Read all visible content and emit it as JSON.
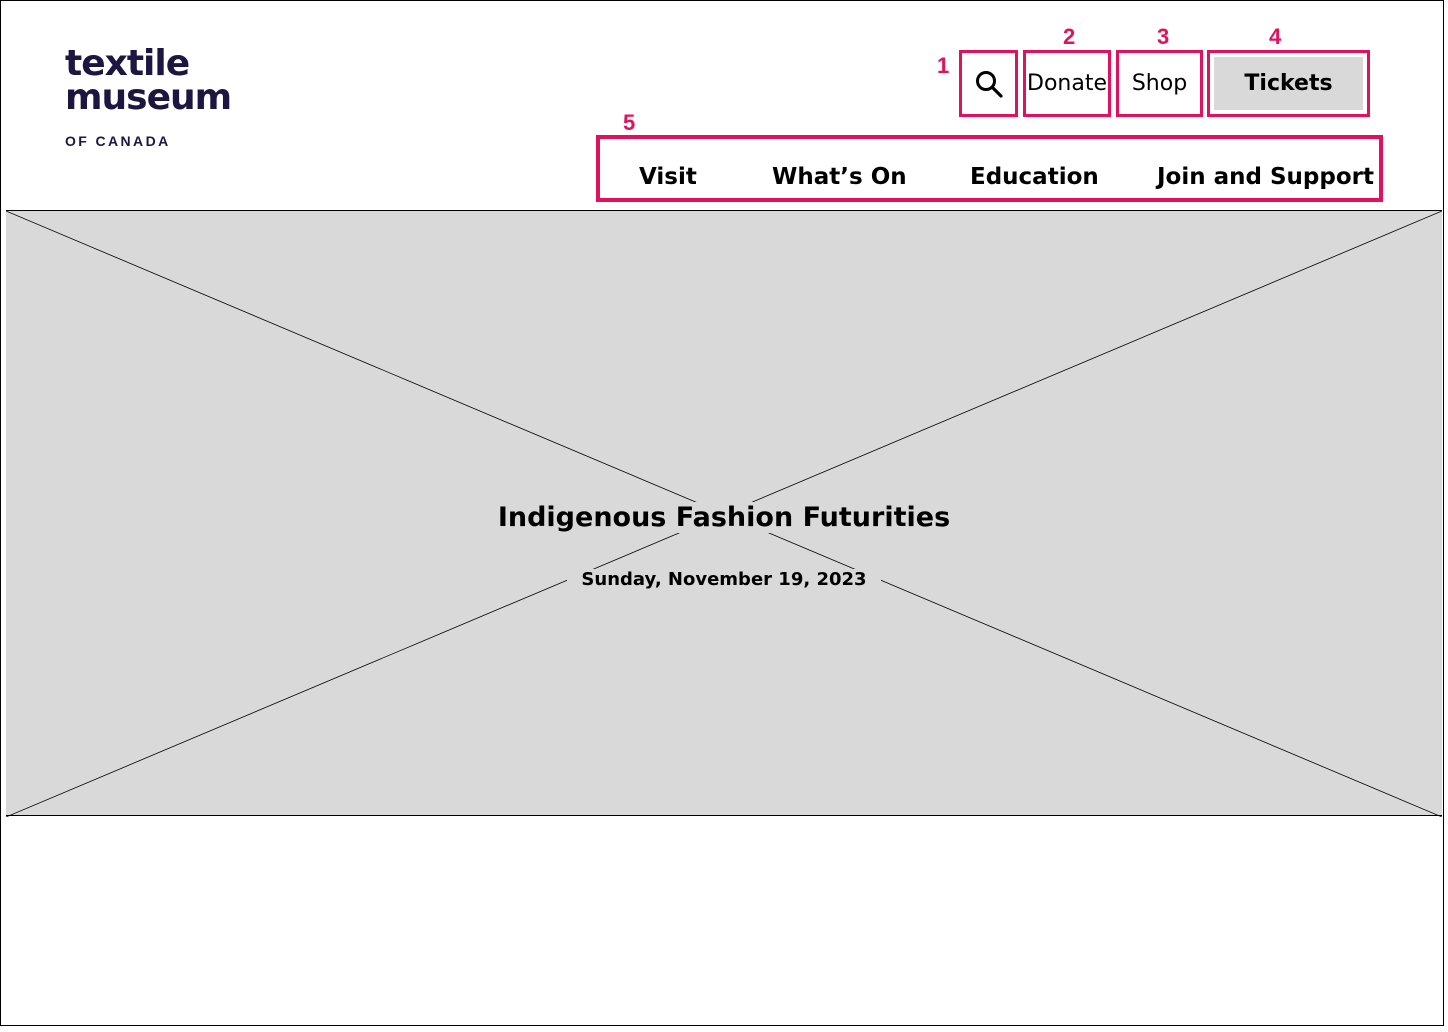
{
  "logo": {
    "line1": "textile",
    "line2": "museum",
    "line3": "OF CANADA"
  },
  "annotations": [
    "1",
    "2",
    "3",
    "4",
    "5"
  ],
  "utility": {
    "search_icon": "search-icon",
    "donate_label": "Donate",
    "shop_label": "Shop",
    "tickets_label": "Tickets"
  },
  "nav": {
    "items": [
      {
        "label": "Visit"
      },
      {
        "label": "What’s On"
      },
      {
        "label": "Education"
      },
      {
        "label": "Join and Support"
      }
    ]
  },
  "hero": {
    "title": "Indigenous Fashion Futurities",
    "date": "Sunday, November 19, 2023",
    "placeholder_color": "#d9d9d9"
  },
  "colors": {
    "annotation": "#e0115f",
    "logo": "#1c1640",
    "tickets_bg": "#d9d9d9"
  }
}
